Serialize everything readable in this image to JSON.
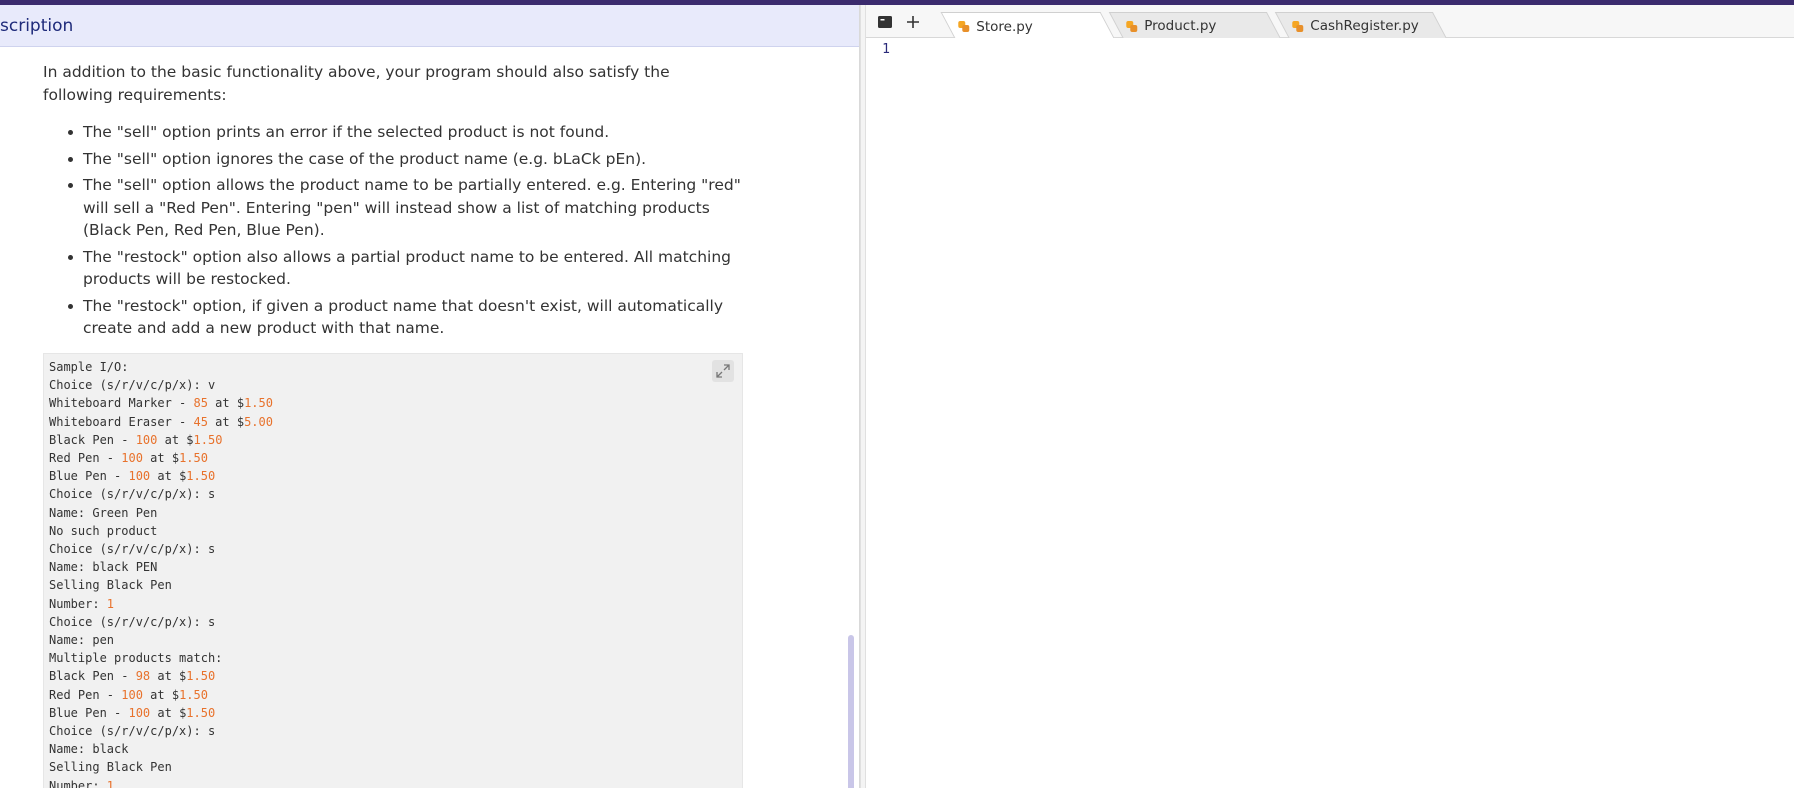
{
  "description": {
    "header_title": "scription",
    "intro": "In addition to the basic functionality above, your program should also satisfy the following requirements:",
    "requirements": [
      "The \"sell\" option prints an error if the selected product is not found.",
      "The \"sell\" option ignores the case of the product name (e.g. bLaCk pEn).",
      "The \"sell\" option allows the product name to be partially entered. e.g. Entering \"red\" will sell a \"Red Pen\". Entering \"pen\" will instead show a list of matching products (Black Pen, Red Pen, Blue Pen).",
      "The \"restock\" option also allows a partial product name to be entered. All matching products will be restocked.",
      "The \"restock\" option, if given a product name that doesn't exist, will automatically create and add a new product with that name."
    ],
    "sample_io": [
      "Sample I/O:",
      "Choice (s/r/v/c/p/x): v",
      "Whiteboard Marker - 85 at $1.50",
      "Whiteboard Eraser - 45 at $5.00",
      "Black Pen - 100 at $1.50",
      "Red Pen - 100 at $1.50",
      "Blue Pen - 100 at $1.50",
      "Choice (s/r/v/c/p/x): s",
      "Name: Green Pen",
      "No such product",
      "Choice (s/r/v/c/p/x): s",
      "Name: black PEN",
      "Selling Black Pen",
      "Number: 1",
      "Choice (s/r/v/c/p/x): s",
      "Name: pen",
      "Multiple products match:",
      "Black Pen - 98 at $1.50",
      "Red Pen - 100 at $1.50",
      "Blue Pen - 100 at $1.50",
      "Choice (s/r/v/c/p/x): s",
      "Name: black",
      "Selling Black Pen",
      "Number: 1"
    ]
  },
  "editor": {
    "tabs": [
      {
        "label": "Store.py",
        "active": true
      },
      {
        "label": "Product.py",
        "active": false
      },
      {
        "label": "CashRegister.py",
        "active": false
      }
    ],
    "line_numbers": [
      "1"
    ],
    "icons": {
      "terminal": "terminal-icon",
      "new_tab": "plus-icon",
      "python": "python-icon",
      "expand": "expand-icon"
    }
  },
  "colors": {
    "header_bg": "#e8eafb",
    "header_text": "#1e2a7a",
    "top_strip": "#3b2b6e",
    "number_highlight": "#e8722c",
    "python_icon": "#f5a623"
  }
}
